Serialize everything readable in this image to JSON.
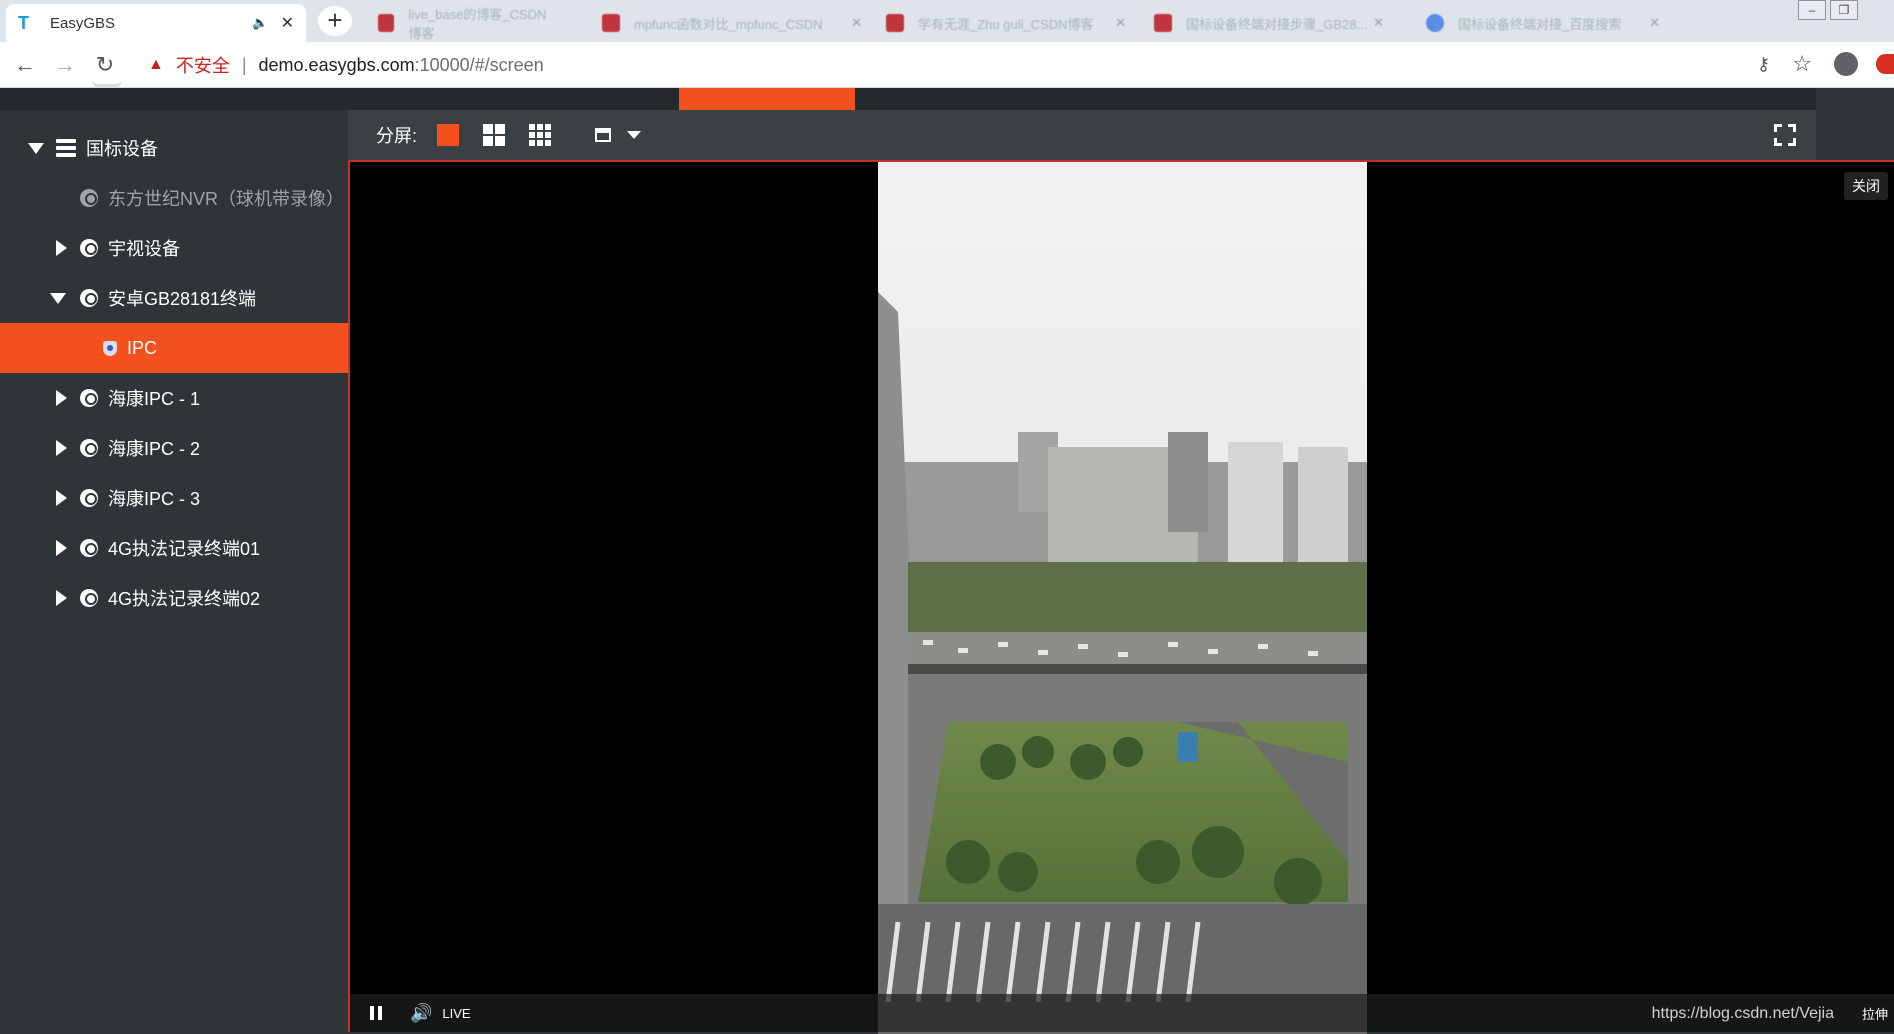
{
  "browser": {
    "active_tab": {
      "title": "EasyGBS",
      "audio_icon": "speaker-icon",
      "close_icon": "close-icon"
    },
    "background_tabs": [
      {
        "title": "live_base的博客_CSDN博客",
        "favicon": "csdn"
      },
      {
        "title": "mpfunc函数对比_mpfunc_CSDN",
        "favicon": "csdn"
      },
      {
        "title": "学有无涯_Zhu guli_CSDN博客",
        "favicon": "csdn"
      },
      {
        "title": "国标设备终端对接步骤_GB28...",
        "favicon": "csdn"
      },
      {
        "title": "国标设备终端对接_百度搜索",
        "favicon": "baidu"
      }
    ],
    "address": {
      "warning_text": "不安全",
      "host": "demo.easygbs.com",
      "path": ":10000/#/screen"
    }
  },
  "sidebar": {
    "root_label": "国标设备",
    "items": [
      {
        "label": "东方世纪NVR（球机带录像）",
        "state": "offline",
        "expander": "none",
        "indent": 1
      },
      {
        "label": "宇视设备",
        "state": "online",
        "expander": "collapsed",
        "indent": 1
      },
      {
        "label": "安卓GB28181终端",
        "state": "online",
        "expander": "expanded",
        "indent": 1
      },
      {
        "label": "IPC",
        "state": "selected",
        "expander": "none",
        "indent": 2
      },
      {
        "label": "海康IPC - 1",
        "state": "online",
        "expander": "collapsed",
        "indent": 1
      },
      {
        "label": "海康IPC - 2",
        "state": "online",
        "expander": "collapsed",
        "indent": 1
      },
      {
        "label": "海康IPC - 3",
        "state": "online",
        "expander": "collapsed",
        "indent": 1
      },
      {
        "label": "4G执法记录终端01",
        "state": "online",
        "expander": "collapsed",
        "indent": 1
      },
      {
        "label": "4G执法记录终端02",
        "state": "online",
        "expander": "collapsed",
        "indent": 1
      }
    ]
  },
  "screen_toolbar": {
    "split_label": "分屏:",
    "split_options": [
      "1",
      "4",
      "9"
    ],
    "selected_split": "1"
  },
  "player": {
    "close_label": "关闭",
    "live_label": "LIVE",
    "watermark": "https://blog.csdn.net/Vejia",
    "stretch_label": "拉伸"
  },
  "colors": {
    "accent": "#f4511e",
    "sidebar_bg": "#2f3437",
    "toolbar_bg": "#3a4043",
    "player_border": "#c7302a"
  }
}
